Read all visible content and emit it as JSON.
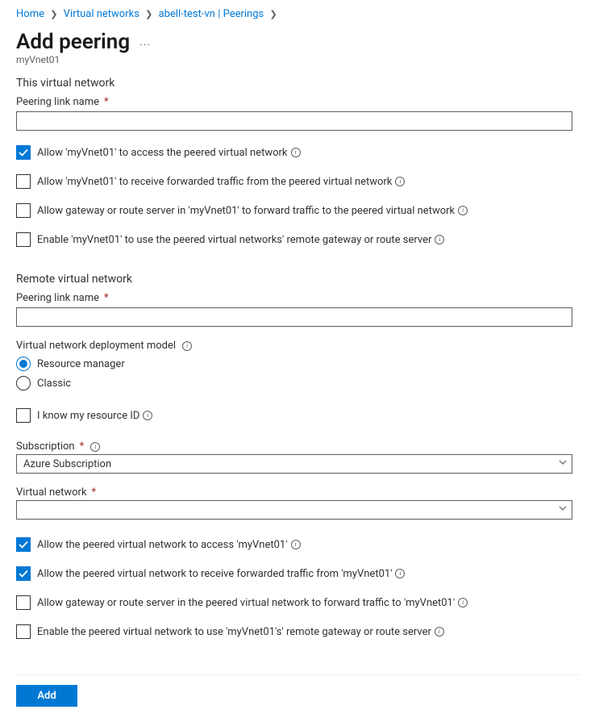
{
  "breadcrumb": {
    "home": "Home",
    "vnet_list": "Virtual networks",
    "vnet_peerings": "abell-test-vn | Peerings"
  },
  "page": {
    "title": "Add peering",
    "subtitle": "myVnet01"
  },
  "this_vnet": {
    "heading": "This virtual network",
    "peering_link_label": "Peering link name",
    "peering_link_value": "",
    "allow_access": {
      "label": "Allow 'myVnet01' to access the peered virtual network",
      "checked": true
    },
    "allow_forwarded": {
      "label": "Allow 'myVnet01' to receive forwarded traffic from the peered virtual network",
      "checked": false
    },
    "allow_gateway_forward": {
      "label": "Allow gateway or route server in 'myVnet01' to forward traffic to the peered virtual network",
      "checked": false
    },
    "use_remote_gateway": {
      "label": "Enable 'myVnet01' to use the peered virtual networks' remote gateway or route server",
      "checked": false
    }
  },
  "remote_vnet": {
    "heading": "Remote virtual network",
    "peering_link_label": "Peering link name",
    "peering_link_value": "",
    "deployment_model_label": "Virtual network deployment model",
    "deployment_model": {
      "resource_manager": "Resource manager",
      "classic": "Classic",
      "selected": "resource_manager"
    },
    "know_resource_id": {
      "label": "I know my resource ID",
      "checked": false
    },
    "subscription_label": "Subscription",
    "subscription_value": "Azure Subscription",
    "virtual_network_label": "Virtual network",
    "virtual_network_value": "",
    "allow_access": {
      "label": "Allow the peered virtual network to access 'myVnet01'",
      "checked": true
    },
    "allow_forwarded": {
      "label": "Allow the peered virtual network to receive forwarded traffic from 'myVnet01'",
      "checked": true
    },
    "allow_gateway_forward": {
      "label": "Allow gateway or route server in the peered virtual network to forward traffic to 'myVnet01'",
      "checked": false
    },
    "use_remote_gateway": {
      "label": "Enable the peered virtual network to use 'myVnet01's' remote gateway or route server",
      "checked": false
    }
  },
  "footer": {
    "add_button": "Add"
  }
}
